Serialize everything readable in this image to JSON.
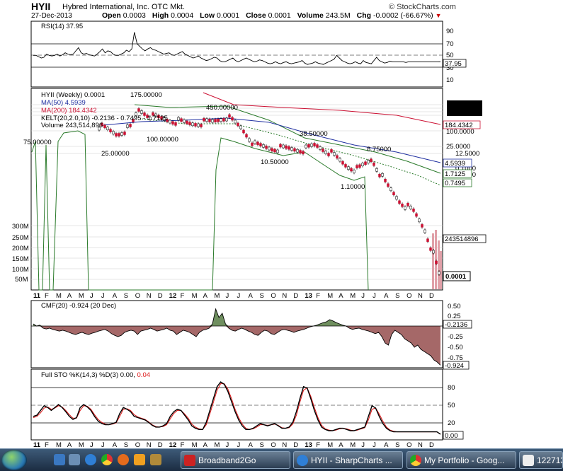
{
  "header": {
    "symbol": "HYII",
    "company": "Hybred International, Inc. OTC Mkt.",
    "date": "27-Dec-2013",
    "open_label": "Open",
    "open": "0.0003",
    "high_label": "High",
    "high": "0.0004",
    "low_label": "Low",
    "low": "0.0001",
    "close_label": "Close",
    "close": "0.0001",
    "volume_label": "Volume",
    "volume": "243.5M",
    "chg_label": "Chg",
    "chg": "-0.0002 (-66.67%)",
    "brand": "© StockCharts.com"
  },
  "colors": {
    "price_up": "#000000",
    "price_down": "#cc1133",
    "ma50": "#1f2fa0",
    "ma200": "#cc1133",
    "kelt": "#2a7a2a",
    "volume": "#e0a0a8",
    "cmf_pos": "#6f8f5f",
    "cmf_neg": "#a56868",
    "sto_k": "#000000",
    "sto_d": "#dd1111"
  },
  "rsi_panel": {
    "label": "RSI(14) 37.95",
    "axis": [
      "90",
      "70",
      "50",
      "30",
      "10"
    ],
    "value_badge": "37.95",
    "series": [
      48,
      48,
      46,
      44,
      45,
      50,
      48,
      47,
      48,
      50,
      47,
      49,
      52,
      50,
      49,
      50,
      55,
      60,
      52,
      50,
      51,
      49,
      48,
      47,
      50,
      54,
      58,
      52,
      55,
      54,
      50,
      48,
      48,
      50,
      52,
      56,
      54,
      58,
      84,
      66,
      62,
      58,
      55,
      58,
      60,
      57,
      56,
      54,
      52,
      50,
      51,
      52,
      49,
      48,
      50,
      52,
      54,
      50,
      48,
      46,
      44,
      45,
      47,
      44,
      42,
      40,
      41,
      43,
      45,
      44,
      40,
      38,
      38,
      40,
      42,
      44,
      40,
      38,
      40,
      42,
      44,
      42,
      40,
      38,
      39,
      41,
      40,
      38,
      36,
      35,
      36,
      38,
      36,
      35,
      37,
      38,
      36,
      35,
      36,
      37,
      38,
      40,
      36,
      34,
      35,
      36,
      38,
      36,
      35,
      34,
      36,
      38,
      40,
      42,
      48,
      44,
      40,
      38,
      36,
      35,
      36,
      38,
      36,
      35,
      40,
      37,
      36,
      35,
      40,
      45,
      40,
      38,
      36,
      37,
      39,
      38,
      38,
      38,
      38,
      38,
      37,
      38,
      38,
      38,
      38,
      38,
      38,
      38,
      38,
      38,
      38,
      38,
      38,
      37.95
    ]
  },
  "price_panel": {
    "legend": {
      "title": "HYII (Weekly) 0.0001",
      "ma50": "MA(50) 4.5939",
      "ma200": "MA(200) 184.4342",
      "kelt": "KELT(20,2.0,10) -0.2136 - 0.7495 - 1.7125",
      "volume": "Volume 243,514,896"
    },
    "axis": [
      "100.0000",
      "25.0000",
      "12.5000",
      "0.1000",
      "0.2500"
    ],
    "badges": {
      "ma200": "184.4342",
      "ma50": "4.5939",
      "kelt_mid": "1.7125",
      "kelt_low": "0.7495",
      "volume": "243514896",
      "close": "0.0001"
    },
    "volume_axis": [
      "300M",
      "250M",
      "200M",
      "150M",
      "100M",
      "50M"
    ],
    "annotations": [
      {
        "text": "75.00000"
      },
      {
        "text": "175.00000"
      },
      {
        "text": "25.00000"
      },
      {
        "text": "100.00000"
      },
      {
        "text": "450.00000"
      },
      {
        "text": "38.50000"
      },
      {
        "text": "10.50000"
      },
      {
        "text": "8.75000"
      },
      {
        "text": "1.10000"
      }
    ],
    "x_labels": [
      "11",
      "F",
      "M",
      "A",
      "M",
      "J",
      "J",
      "A",
      "S",
      "O",
      "N",
      "D",
      "12",
      "F",
      "M",
      "A",
      "M",
      "J",
      "J",
      "A",
      "S",
      "O",
      "N",
      "D",
      "13",
      "F",
      "M",
      "A",
      "M",
      "J",
      "J",
      "A",
      "S",
      "O",
      "N",
      "D"
    ]
  },
  "cmf_panel": {
    "label": "CMF(20) -0.924 (20 Dec)",
    "axis": [
      "0.50",
      "0.25",
      "-0.25",
      "-0.50",
      "-0.75"
    ],
    "badges": {
      "value": "-0.2136",
      "current": "-0.924"
    },
    "series": [
      0.05,
      0,
      0.02,
      -0.05,
      -0.07,
      -0.05,
      -0.08,
      -0.1,
      -0.12,
      -0.1,
      -0.12,
      -0.15,
      -0.18,
      -0.2,
      -0.17,
      -0.15,
      -0.18,
      -0.2,
      -0.17,
      -0.15,
      -0.12,
      -0.1,
      -0.08,
      -0.12,
      -0.18,
      -0.22,
      -0.25,
      -0.22,
      -0.15,
      -0.12,
      -0.1,
      -0.12,
      -0.2,
      -0.12,
      -0.1,
      -0.08,
      -0.05,
      -0.08,
      -0.12,
      -0.1,
      -0.08,
      -0.05,
      -0.1,
      -0.12,
      -0.2,
      -0.15,
      -0.1,
      -0.12,
      -0.15,
      -0.2,
      -0.25,
      -0.15,
      -0.1,
      -0.08,
      -0.05,
      0.05,
      0.4,
      0.2,
      0.3,
      0.05,
      -0.05,
      -0.1,
      -0.12,
      -0.08,
      -0.05,
      -0.08,
      -0.12,
      -0.15,
      -0.2,
      -0.22,
      -0.15,
      -0.1,
      -0.12,
      -0.18,
      -0.2,
      -0.15,
      -0.1,
      -0.08,
      -0.1,
      -0.12,
      -0.15,
      -0.12,
      -0.1,
      -0.08,
      -0.05,
      -0.02,
      0,
      0.02,
      0.05,
      0.08,
      0.1,
      0.15,
      0.12,
      0.08,
      0.05,
      0.02,
      0,
      -0.05,
      -0.08,
      -0.06,
      -0.05,
      -0.08,
      -0.1,
      -0.12,
      -0.15,
      -0.18,
      -0.15,
      -0.25,
      -0.4,
      -0.45,
      -0.2,
      -0.1,
      -0.15,
      -0.2,
      -0.3,
      -0.35,
      -0.4,
      -0.5,
      -0.45,
      -0.55,
      -0.6,
      -0.65,
      -0.7,
      -0.8,
      -0.85,
      -0.924
    ]
  },
  "sto_panel": {
    "label_prefix": "Full STO %K(14,3) %D(3) 0.00,",
    "label_d": "0.04",
    "axis": [
      "80",
      "50",
      "20"
    ],
    "badge": "0.00",
    "k": [
      30,
      32,
      40,
      48,
      45,
      40,
      45,
      50,
      45,
      38,
      30,
      25,
      28,
      45,
      50,
      46,
      40,
      30,
      22,
      18,
      16,
      16,
      18,
      20,
      35,
      45,
      42,
      38,
      30,
      28,
      26,
      24,
      20,
      15,
      12,
      12,
      14,
      18,
      30,
      38,
      42,
      40,
      32,
      24,
      14,
      10,
      8,
      8,
      20,
      40,
      60,
      80,
      88,
      84,
      72,
      55,
      38,
      24,
      14,
      8,
      8,
      10,
      14,
      18,
      16,
      14,
      16,
      18,
      14,
      10,
      10,
      12,
      20,
      38,
      60,
      80,
      78,
      60,
      40,
      24,
      12,
      8,
      6,
      6,
      8,
      10,
      10,
      8,
      6,
      6,
      8,
      10,
      12,
      30,
      48,
      44,
      30,
      18,
      10,
      6,
      4,
      4,
      4,
      4,
      4,
      4,
      4,
      4,
      4,
      4,
      4,
      4,
      4,
      0
    ],
    "d": [
      28,
      30,
      36,
      44,
      46,
      42,
      44,
      48,
      46,
      40,
      33,
      27,
      27,
      40,
      48,
      47,
      42,
      33,
      25,
      20,
      17,
      16,
      17,
      19,
      30,
      42,
      43,
      40,
      33,
      29,
      27,
      25,
      21,
      16,
      13,
      12,
      13,
      16,
      26,
      35,
      40,
      40,
      34,
      27,
      17,
      12,
      9,
      8,
      16,
      34,
      54,
      74,
      85,
      85,
      76,
      60,
      42,
      28,
      17,
      10,
      8,
      9,
      12,
      16,
      16,
      15,
      16,
      17,
      15,
      11,
      10,
      11,
      17,
      32,
      54,
      74,
      78,
      64,
      45,
      28,
      15,
      9,
      7,
      6,
      7,
      9,
      10,
      9,
      7,
      6,
      7,
      9,
      11,
      24,
      42,
      44,
      34,
      22,
      12,
      7,
      5,
      4,
      4,
      4,
      4,
      4,
      4,
      4,
      4,
      4,
      4,
      4,
      4,
      0.04
    ],
    "x_labels": [
      "11",
      "F",
      "M",
      "A",
      "M",
      "J",
      "J",
      "A",
      "S",
      "O",
      "N",
      "D",
      "12",
      "F",
      "M",
      "A",
      "M",
      "J",
      "J",
      "A",
      "S",
      "O",
      "N",
      "D",
      "13",
      "F",
      "M",
      "A",
      "M",
      "J",
      "J",
      "A",
      "S",
      "O",
      "N",
      "D"
    ]
  },
  "taskbar": {
    "items": [
      {
        "label": "Broadband2Go"
      },
      {
        "label": "HYII - SharpCharts ..."
      },
      {
        "label": "My Portfolio - Goog..."
      },
      {
        "label": "122713"
      }
    ]
  }
}
